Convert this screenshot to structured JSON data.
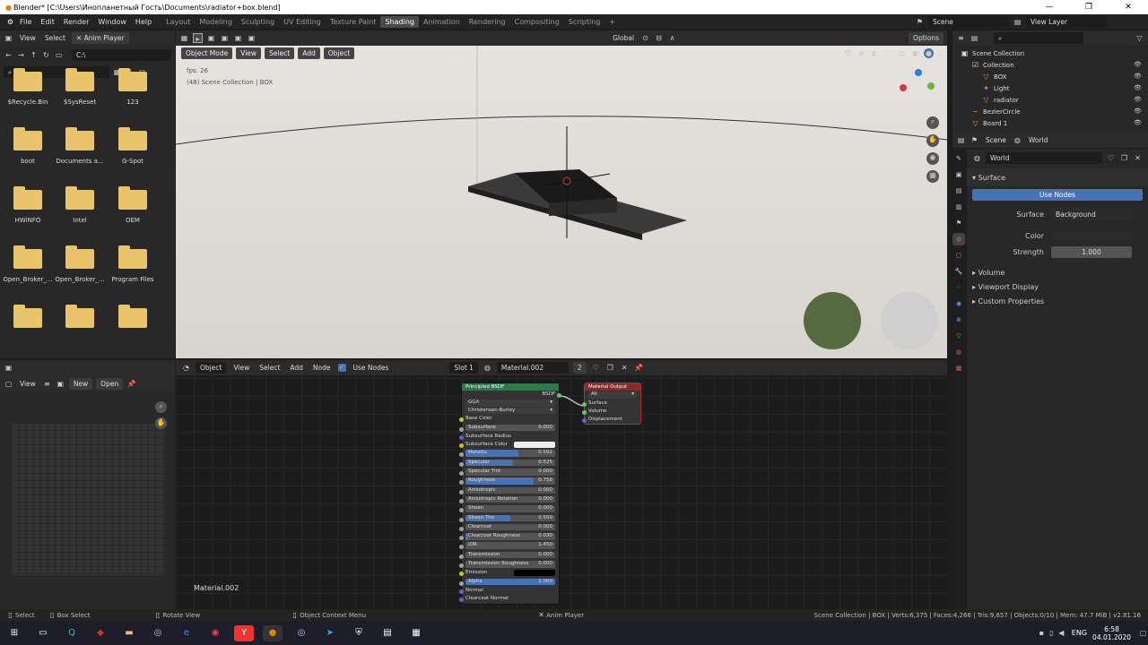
{
  "window": {
    "title": "Blender* [C:\\Users\\Инопланетный Гость\\Documents\\radiator+box.blend]"
  },
  "menu": [
    "File",
    "Edit",
    "Render",
    "Window",
    "Help"
  ],
  "workspaces": [
    "Layout",
    "Modeling",
    "Sculpting",
    "UV Editing",
    "Texture Paint",
    "Shading",
    "Animation",
    "Rendering",
    "Compositing",
    "Scripting"
  ],
  "active_workspace": "Shading",
  "scene": {
    "name": "Scene",
    "view_layer": "View Layer"
  },
  "filebrowser": {
    "view": "View",
    "select": "Select",
    "anim_player": "Anim Player",
    "path": "C:\\",
    "folders": [
      "$Recycle.Bin",
      "$SysReset",
      "123",
      "boot",
      "Documents a...",
      "G-Spot",
      "HWiNFO",
      "Intel",
      "OEM",
      "Open_Broker_...",
      "Open_Broker_...",
      "Program Files",
      "",
      "",
      ""
    ]
  },
  "viewport": {
    "mode": "Object Mode",
    "view": "View",
    "select": "Select",
    "add": "Add",
    "object": "Object",
    "transform": "Global",
    "options": "Options",
    "fps": "fps: 26",
    "info": "(48) Scene Collection | BOX"
  },
  "node_editor": {
    "editor": "Object",
    "view": "View",
    "select": "Select",
    "add": "Add",
    "node": "Node",
    "use_nodes": "Use Nodes",
    "slot": "Slot 1",
    "material": "Material.002",
    "users": "2",
    "label": "Material.002",
    "bsdf": {
      "title": "Principled BSDF",
      "out": "BSDF",
      "dist": "GGX",
      "sss": "Christensen-Burley",
      "inputs": [
        {
          "name": "Base Color",
          "value": "",
          "fill": 0,
          "color": "#c7c729"
        },
        {
          "name": "Subsurface",
          "value": "0.000",
          "fill": 0,
          "color": "#a1a1a1"
        },
        {
          "name": "Subsurface Radius",
          "value": "",
          "fill": 0,
          "color": "#6363c7"
        },
        {
          "name": "Subsurface Color",
          "value": "",
          "fill": 0,
          "color": "#c7c729"
        },
        {
          "name": "Metallic",
          "value": "0.592",
          "fill": 0.592,
          "color": "#a1a1a1"
        },
        {
          "name": "Specular",
          "value": "0.525",
          "fill": 0.525,
          "color": "#a1a1a1"
        },
        {
          "name": "Specular Tint",
          "value": "0.000",
          "fill": 0,
          "color": "#a1a1a1"
        },
        {
          "name": "Roughness",
          "value": "0.758",
          "fill": 0.758,
          "color": "#a1a1a1"
        },
        {
          "name": "Anisotropic",
          "value": "0.000",
          "fill": 0,
          "color": "#a1a1a1"
        },
        {
          "name": "Anisotropic Rotation",
          "value": "0.000",
          "fill": 0,
          "color": "#a1a1a1"
        },
        {
          "name": "Sheen",
          "value": "0.000",
          "fill": 0,
          "color": "#a1a1a1"
        },
        {
          "name": "Sheen Tint",
          "value": "0.500",
          "fill": 0.5,
          "color": "#a1a1a1"
        },
        {
          "name": "Clearcoat",
          "value": "0.000",
          "fill": 0,
          "color": "#a1a1a1"
        },
        {
          "name": "Clearcoat Roughness",
          "value": "0.030",
          "fill": 0.03,
          "color": "#a1a1a1"
        },
        {
          "name": "IOR",
          "value": "1.450",
          "fill": 0,
          "color": "#a1a1a1"
        },
        {
          "name": "Transmission",
          "value": "0.000",
          "fill": 0,
          "color": "#a1a1a1"
        },
        {
          "name": "Transmission Roughness",
          "value": "0.000",
          "fill": 0,
          "color": "#a1a1a1"
        },
        {
          "name": "Emission",
          "value": "",
          "fill": 0,
          "color": "#c7c729"
        },
        {
          "name": "Alpha",
          "value": "1.000",
          "fill": 1,
          "color": "#a1a1a1"
        },
        {
          "name": "Normal",
          "value": "",
          "fill": 0,
          "color": "#6363c7"
        },
        {
          "name": "Clearcoat Normal",
          "value": "",
          "fill": 0,
          "color": "#6363c7"
        }
      ]
    },
    "output": {
      "title": "Material Output",
      "target": "All",
      "sockets": [
        "Surface",
        "Volume",
        "Displacement"
      ]
    }
  },
  "image_viewer": {
    "view": "View",
    "new": "New",
    "open": "Open"
  },
  "outliner": {
    "items": [
      {
        "name": "Scene Collection",
        "indent": 0,
        "icon": "scene-collection-icon"
      },
      {
        "name": "Collection",
        "indent": 1,
        "icon": "collection-icon"
      },
      {
        "name": "BOX",
        "indent": 2,
        "icon": "mesh-icon"
      },
      {
        "name": "Light",
        "indent": 2,
        "icon": "light-icon"
      },
      {
        "name": "radiator",
        "indent": 2,
        "icon": "mesh-icon"
      },
      {
        "name": "BezierCircle",
        "indent": 1,
        "icon": "curve-icon"
      },
      {
        "name": "Board 1",
        "indent": 1,
        "icon": "mesh-icon"
      }
    ]
  },
  "properties": {
    "scene_tab": "Scene",
    "world_tab": "World",
    "world": "World",
    "surface": "Surface",
    "use_nodes": "Use Nodes",
    "surface_label": "Surface",
    "surface_value": "Background",
    "color_label": "Color",
    "strength_label": "Strength",
    "strength": "1.000",
    "panels": [
      "Volume",
      "Viewport Display",
      "Custom Properties"
    ]
  },
  "status": {
    "select": "Select",
    "box_select": "Box Select",
    "rotate": "Rotate View",
    "context": "Object Context Menu",
    "anim": "Anim Player",
    "stats": "Scene Collection | BOX | Verts:6,375 | Faces:4,266 | Tris:9,657 | Objects:0/10 | Mem: 47.7 MiB | v2.81.16"
  },
  "taskbar": {
    "time": "6:58",
    "date": "04.01.2020",
    "lang": "ENG"
  }
}
